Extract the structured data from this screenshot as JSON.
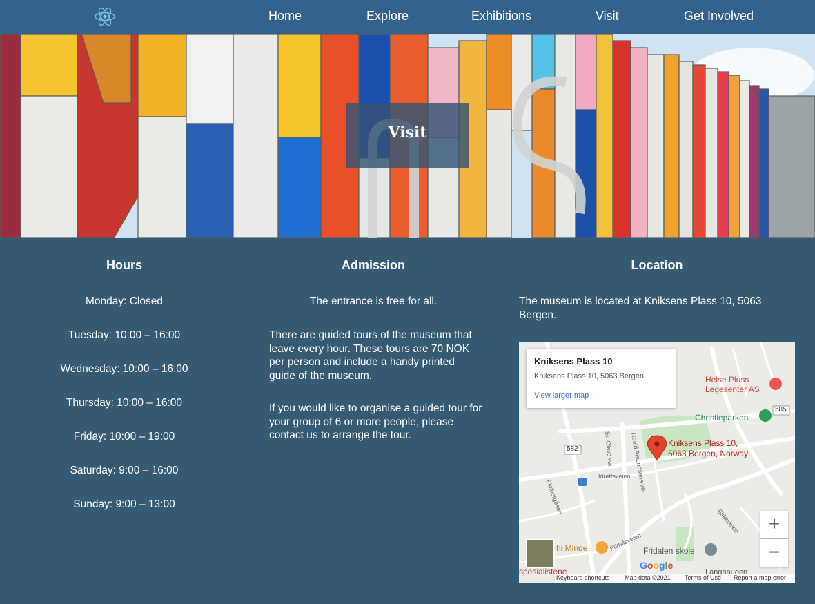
{
  "nav": {
    "logo_icon": "atom-icon",
    "links": [
      {
        "label": "Home"
      },
      {
        "label": "Explore"
      },
      {
        "label": "Exhibitions"
      },
      {
        "label": "Visit",
        "active": true
      },
      {
        "label": "Get Involved"
      }
    ]
  },
  "hero": {
    "title": "Visit"
  },
  "hours": {
    "heading": "Hours",
    "lines": [
      "Monday: Closed",
      "Tuesday: 10:00 – 16:00",
      "Wednesday: 10:00 – 16:00",
      "Thursday: 10:00 – 16:00",
      "Friday: 10:00 – 19:00",
      "Saturday: 9:00 – 16:00",
      "Sunday: 9:00 – 13:00"
    ]
  },
  "admission": {
    "heading": "Admission",
    "paragraphs": [
      "The entrance is free for all.",
      "There are guided tours of the museum that leave every hour. These tours are 70 NOK per person and include a handy printed guide of the museum.",
      "If you would like to organise a guided tour for your group of 6 or more people, please contact us to arrange the tour."
    ]
  },
  "location": {
    "heading": "Location",
    "text": "The museum is located at Kniksens Plass 10, 5063 Bergen.",
    "map": {
      "card_title": "Kniksens Plass 10",
      "card_address": "Kniksens Plass 10, 5063 Bergen",
      "card_link": "View larger map",
      "pin_label_1": "Kniksens Plass 10,",
      "pin_label_2": "5063 Bergen, Norway",
      "places": {
        "helse_1": "Helse Pluss",
        "helse_2": "Legesenter AS",
        "park": "Christieparken",
        "school": "Fridalen skole",
        "minde": "hi Minde",
        "spes": "spesialistene",
        "lang": "Langhaugen"
      },
      "roads": {
        "r582": "582",
        "r585": "585",
        "idretts": "Idrettsveien",
        "fridals": "Fridalsveien",
        "fimbe": "Fimbergåsen",
        "stolavs": "St. Olavs vei",
        "roald": "Roald Amundsens vei",
        "birke": "Birkeveien"
      },
      "zoom_in": "+",
      "zoom_out": "−",
      "footer": {
        "shortcuts": "Keyboard shortcuts",
        "data": "Map data ©2021",
        "terms": "Terms of Use",
        "report": "Report a map error"
      },
      "brand": "Google"
    }
  },
  "colors": {
    "nav_bg": "#33638c",
    "page_bg": "#355a73",
    "hero_overlay": "#345473"
  }
}
